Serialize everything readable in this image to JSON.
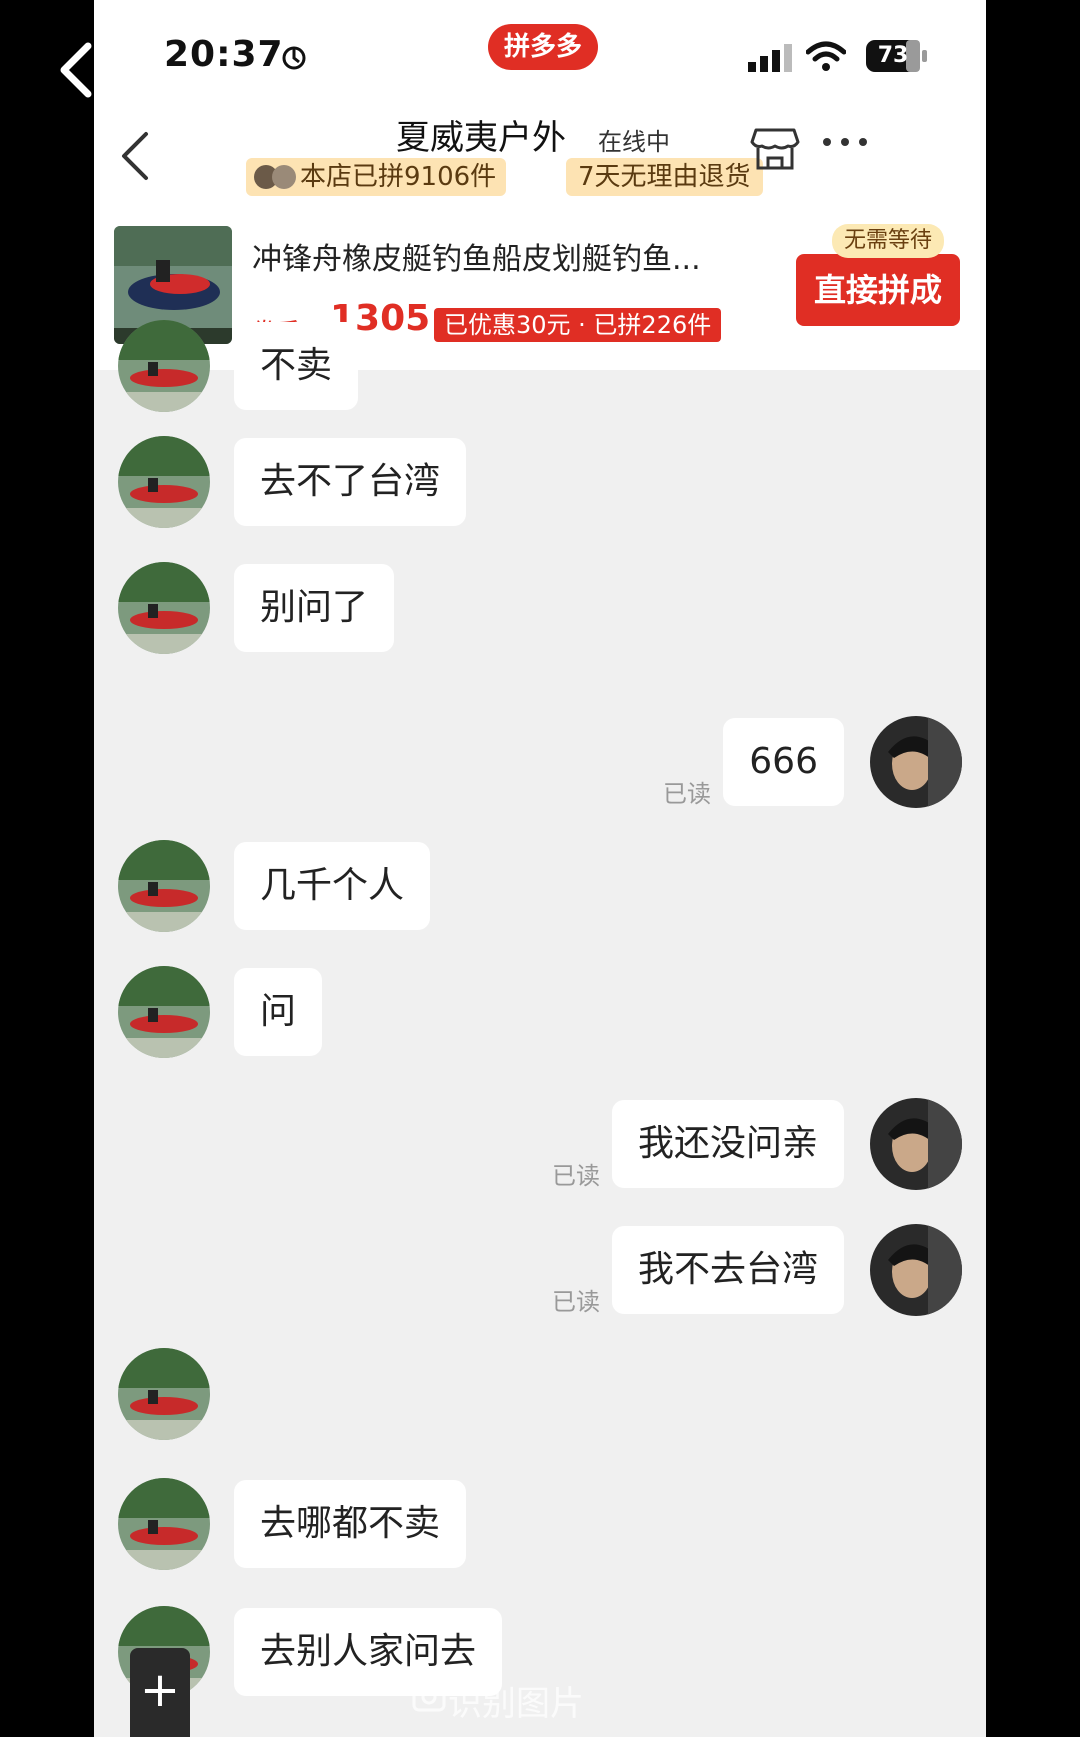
{
  "status_bar": {
    "time": "20:37",
    "battery": "73",
    "app_logo": "拼多多"
  },
  "header": {
    "shop_name": "夏威夷户外",
    "status": "在线中",
    "tag_sales": "本店已拼9106件",
    "tag_return": "7天无理由退货"
  },
  "product": {
    "title": "冲锋舟橡皮艇钓鱼船皮划艇钓鱼...",
    "price_prefix": "券后 ¥",
    "price": "1305",
    "promo": "已优惠30元 · 已拼226件",
    "badge": "无需等待",
    "buy_button": "直接拼成"
  },
  "messages": [
    {
      "side": "left",
      "text": "不卖"
    },
    {
      "side": "left",
      "text": "去不了台湾"
    },
    {
      "side": "left",
      "text": "别问了"
    },
    {
      "side": "right",
      "text": "666",
      "read": "已读"
    },
    {
      "side": "left",
      "text": "几千个人"
    },
    {
      "side": "left",
      "text": "问"
    },
    {
      "side": "right",
      "text": "我还没问亲",
      "read": "已读"
    },
    {
      "side": "right",
      "text": "我不去台湾",
      "read": "已读"
    },
    {
      "side": "left",
      "text": ""
    },
    {
      "side": "left",
      "text": "去哪都不卖"
    },
    {
      "side": "left",
      "text": "去别人家问去"
    }
  ],
  "bottom_bar": {
    "plus": "+",
    "ocr_label": "识别图片"
  },
  "colors": {
    "brand_red": "#e02e24",
    "tag_bg": "#fde3b3",
    "chat_bg": "#f0f0f0"
  },
  "icons": [
    "back-icon",
    "flame-icon",
    "signal-icon",
    "wifi-icon",
    "battery-icon",
    "store-icon",
    "more-icon",
    "ocr-icon"
  ]
}
